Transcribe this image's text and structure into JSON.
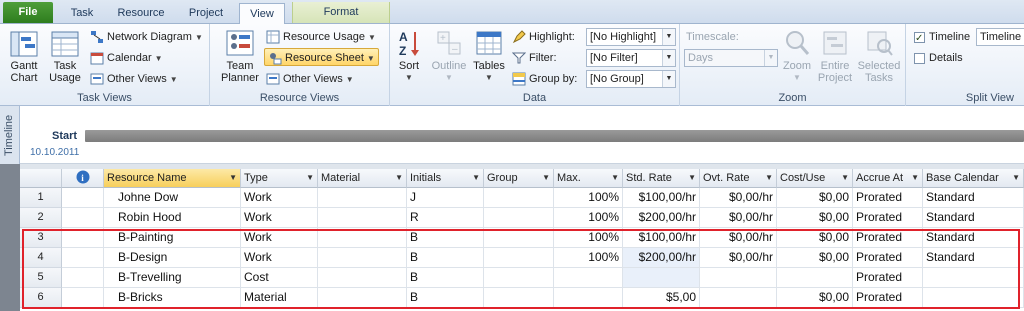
{
  "tabs": [
    "File",
    "Task",
    "Resource",
    "Project",
    "View",
    "Format"
  ],
  "ribbon": {
    "task_views": {
      "group_label": "Task Views",
      "gantt": "Gantt Chart",
      "task_usage": "Task Usage",
      "network_diagram": "Network Diagram",
      "calendar": "Calendar",
      "other_views": "Other Views"
    },
    "resource_views": {
      "group_label": "Resource Views",
      "team_planner": "Team Planner",
      "resource_usage": "Resource Usage",
      "resource_sheet": "Resource Sheet",
      "other_views": "Other Views"
    },
    "data": {
      "group_label": "Data",
      "sort": "Sort",
      "outline": "Outline",
      "tables": "Tables",
      "highlight_label": "Highlight:",
      "highlight_value": "[No Highlight]",
      "filter_label": "Filter:",
      "filter_value": "[No Filter]",
      "groupby_label": "Group by:",
      "groupby_value": "[No Group]"
    },
    "zoom": {
      "group_label": "Zoom",
      "timescale_label": "Timescale:",
      "timescale_value": "Days",
      "zoom": "Zoom",
      "entire_project": "Entire Project",
      "selected_tasks": "Selected Tasks"
    },
    "split_view": {
      "group_label": "Split View",
      "timeline_label": "Timeline",
      "timeline_value": "Timeline",
      "details_label": "Details"
    }
  },
  "timeline": {
    "side_label": "Timeline",
    "start_label": "Start",
    "start_date": "10.10.2011"
  },
  "sheet": {
    "columns": [
      "Resource Name",
      "Type",
      "Material",
      "Initials",
      "Group",
      "Max.",
      "Std. Rate",
      "Ovt. Rate",
      "Cost/Use",
      "Accrue At",
      "Base Calendar"
    ],
    "rows": [
      {
        "id": "1",
        "name": "Johne Dow",
        "type": "Work",
        "material": "",
        "initials": "J",
        "group": "",
        "max": "100%",
        "std_rate": "$100,00/hr",
        "ovt_rate": "$0,00/hr",
        "cost_use": "$0,00",
        "accrue": "Prorated",
        "calendar": "Standard"
      },
      {
        "id": "2",
        "name": "Robin Hood",
        "type": "Work",
        "material": "",
        "initials": "R",
        "group": "",
        "max": "100%",
        "std_rate": "$200,00/hr",
        "ovt_rate": "$0,00/hr",
        "cost_use": "$0,00",
        "accrue": "Prorated",
        "calendar": "Standard"
      },
      {
        "id": "3",
        "name": "B-Painting",
        "type": "Work",
        "material": "",
        "initials": "B",
        "group": "",
        "max": "100%",
        "std_rate": "$100,00/hr",
        "ovt_rate": "$0,00/hr",
        "cost_use": "$0,00",
        "accrue": "Prorated",
        "calendar": "Standard"
      },
      {
        "id": "4",
        "name": "B-Design",
        "type": "Work",
        "material": "",
        "initials": "B",
        "group": "",
        "max": "100%",
        "std_rate": "$200,00/hr",
        "ovt_rate": "$0,00/hr",
        "cost_use": "$0,00",
        "accrue": "Prorated",
        "calendar": "Standard"
      },
      {
        "id": "5",
        "name": "B-Trevelling",
        "type": "Cost",
        "material": "",
        "initials": "B",
        "group": "",
        "max": "",
        "std_rate": "",
        "ovt_rate": "",
        "cost_use": "",
        "accrue": "Prorated",
        "calendar": ""
      },
      {
        "id": "6",
        "name": "B-Bricks",
        "type": "Material",
        "material": "",
        "initials": "B",
        "group": "",
        "max": "",
        "std_rate": "$5,00",
        "ovt_rate": "",
        "cost_use": "$0,00",
        "accrue": "Prorated",
        "calendar": ""
      }
    ]
  },
  "colors": {
    "file_tab": "#2e7d1e",
    "selected_header": "#f7cf5c",
    "highlight_box": "#e0222b",
    "info_icon": "#2f6fc1"
  }
}
